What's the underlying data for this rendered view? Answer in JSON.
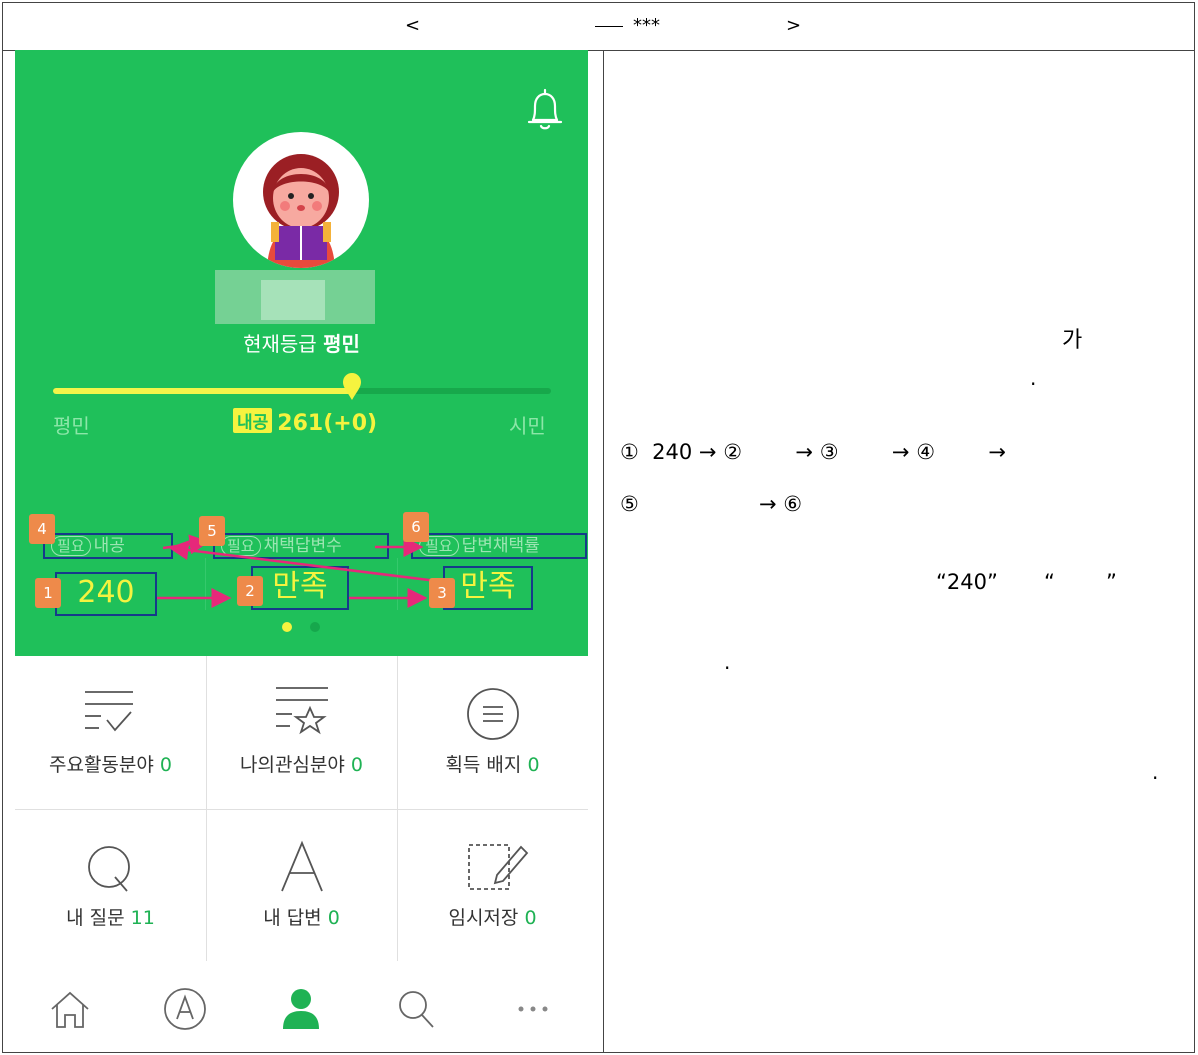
{
  "header": {
    "open_bracket": "<",
    "stars": "***",
    "close_bracket": ">"
  },
  "profile": {
    "grade_prefix": "현재등급",
    "grade_value": "평민",
    "level_left": "평민",
    "level_right": "시민",
    "naegong_tag": "내공",
    "naegong_value": "261(+0)",
    "progress": 0.6
  },
  "stats": {
    "label_1": "내공",
    "label_2": "채택답변수",
    "label_3": "답변채택률",
    "required_pill": "필요",
    "value_1": "240",
    "value_2": "만족",
    "value_3": "만족"
  },
  "badges": [
    "1",
    "2",
    "3",
    "4",
    "5",
    "6"
  ],
  "menu": [
    {
      "label": "주요활동분야",
      "count": "0",
      "icon": "checklist-icon"
    },
    {
      "label": "나의관심분야",
      "count": "0",
      "icon": "star-list-icon"
    },
    {
      "label": "획득 배지",
      "count": "0",
      "icon": "menu-circle-icon"
    },
    {
      "label": "내 질문",
      "count": "11",
      "icon": "question-q-icon"
    },
    {
      "label": "내 답변",
      "count": "0",
      "icon": "answer-a-icon"
    },
    {
      "label": "임시저장",
      "count": "0",
      "icon": "draft-pencil-icon"
    }
  ],
  "bottom_nav": [
    "home-icon",
    "answer-icon",
    "profile-icon",
    "search-icon",
    "more-icon"
  ],
  "right_text": {
    "ga": "가",
    "dot1": ".",
    "step_line_1": "①  240 → ②        → ③        → ④        →",
    "step_line_2": "⑤                  → ⑥",
    "quote_240": "“240”",
    "quote_open": "“",
    "quote_close": "”",
    "dot2": ".",
    "dot3": "."
  },
  "colors": {
    "green": "#1fc05a",
    "yellow": "#f5f33f",
    "box_blue": "#163a8a",
    "badge_orange": "#ee8a4a",
    "arrow_pink": "#e6287a"
  }
}
